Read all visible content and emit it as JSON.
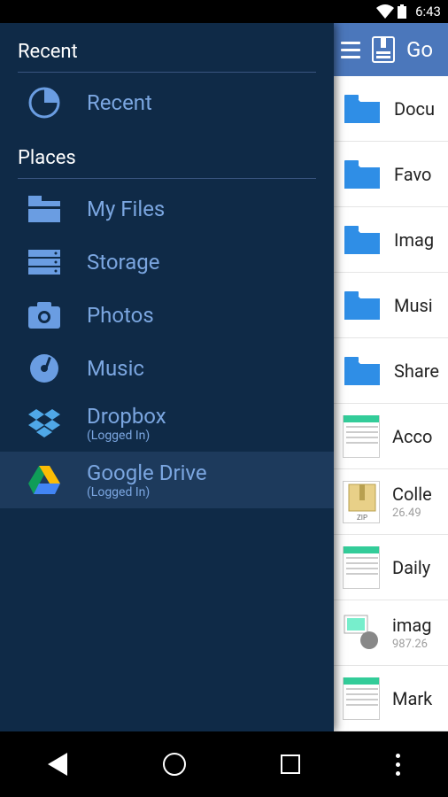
{
  "status": {
    "time": "6:43"
  },
  "app_header": {
    "title": "Go"
  },
  "drawer": {
    "section_recent": "Recent",
    "section_places": "Places",
    "recent_item": {
      "label": "Recent"
    },
    "places": [
      {
        "label": "My Files",
        "sub": ""
      },
      {
        "label": "Storage",
        "sub": ""
      },
      {
        "label": "Photos",
        "sub": ""
      },
      {
        "label": "Music",
        "sub": ""
      },
      {
        "label": "Dropbox",
        "sub": "(Logged In)"
      },
      {
        "label": "Google Drive",
        "sub": "(Logged In)"
      }
    ]
  },
  "files": [
    {
      "name": "Docu",
      "type": "folder",
      "sub": ""
    },
    {
      "name": "Favo",
      "type": "folder",
      "sub": ""
    },
    {
      "name": "Imag",
      "type": "folder",
      "sub": ""
    },
    {
      "name": "Musi",
      "type": "folder",
      "sub": ""
    },
    {
      "name": "Share",
      "type": "folder",
      "sub": ""
    },
    {
      "name": "Acco",
      "type": "spreadsheet",
      "sub": ""
    },
    {
      "name": "Colle",
      "type": "zip",
      "sub": "26.49 "
    },
    {
      "name": "Daily",
      "type": "spreadsheet",
      "sub": ""
    },
    {
      "name": "imag",
      "type": "image",
      "sub": "987.26"
    },
    {
      "name": "Mark",
      "type": "spreadsheet",
      "sub": ""
    }
  ]
}
